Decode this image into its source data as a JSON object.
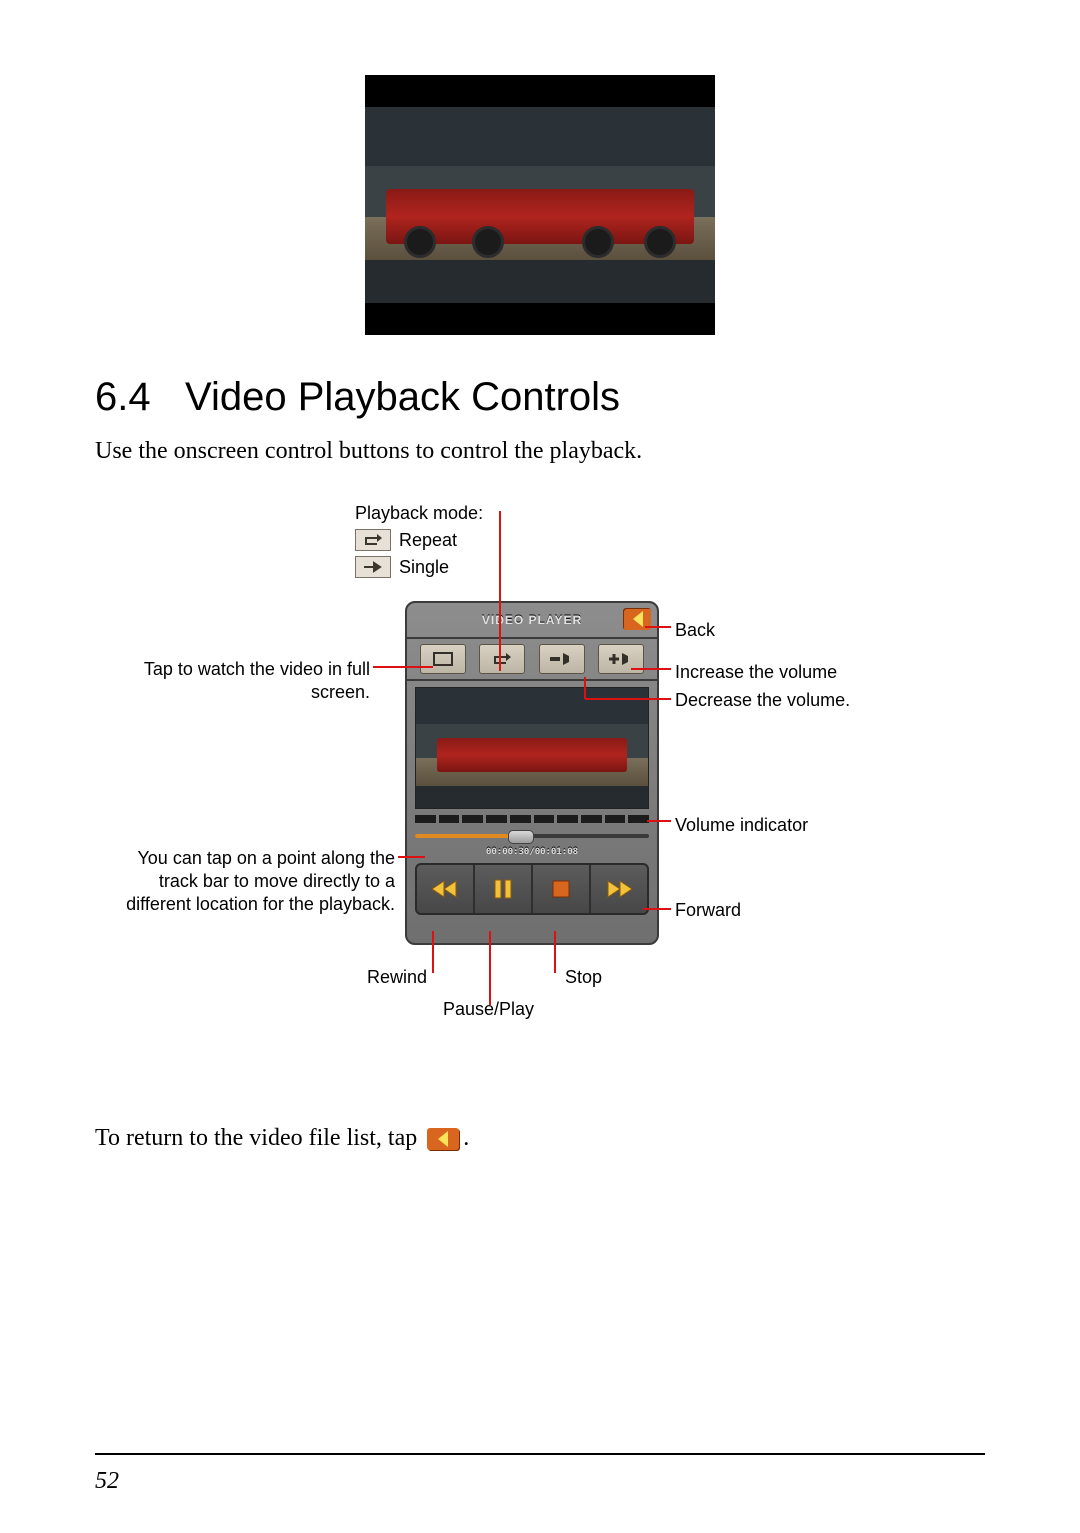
{
  "section": {
    "number": "6.4",
    "title": "Video Playback Controls"
  },
  "intro": "Use the onscreen control buttons to control the playback.",
  "playback_mode": {
    "heading": "Playback mode:",
    "repeat": "Repeat",
    "single": "Single"
  },
  "labels": {
    "fullscreen": "Tap to watch the video in full screen.",
    "trackbar": "You can tap on a point along the track bar to move directly to a different location for the playback.",
    "back": "Back",
    "vol_up": "Increase the volume",
    "vol_down": "Decrease the volume.",
    "vol_ind": "Volume indicator",
    "forward": "Forward",
    "rewind": "Rewind",
    "pauseplay": "Pause/Play",
    "stop": "Stop"
  },
  "player": {
    "title": "VIDEO PLAYER",
    "time": "00:00:30/00:01:08"
  },
  "return_text_before": "To return to the video file list, tap ",
  "return_text_after": ".",
  "page_number": "52"
}
